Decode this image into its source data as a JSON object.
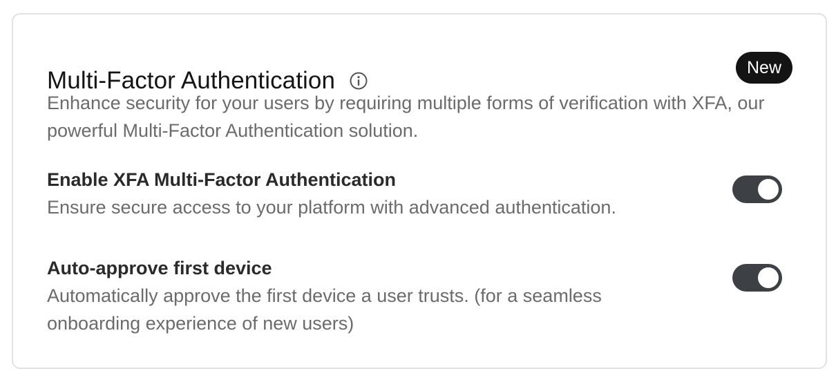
{
  "section": {
    "title": "Multi-Factor Authentication",
    "badge": "New",
    "description": "Enhance security for your users by requiring multiple forms of verification with XFA, our powerful Multi-Factor Authentication solution."
  },
  "settings": [
    {
      "label": "Enable XFA Multi-Factor Authentication",
      "description": "Ensure secure access to your platform with advanced authentication.",
      "enabled": true
    },
    {
      "label": "Auto-approve first device",
      "description": "Automatically approve the first device a user trusts. (for a seamless onboarding experience of new users)",
      "enabled": true
    }
  ],
  "icons": {
    "info": "info-icon"
  },
  "colors": {
    "toggle_on": "#3d4045",
    "badge_bg": "#141414",
    "muted_text": "#6b6b6b"
  }
}
